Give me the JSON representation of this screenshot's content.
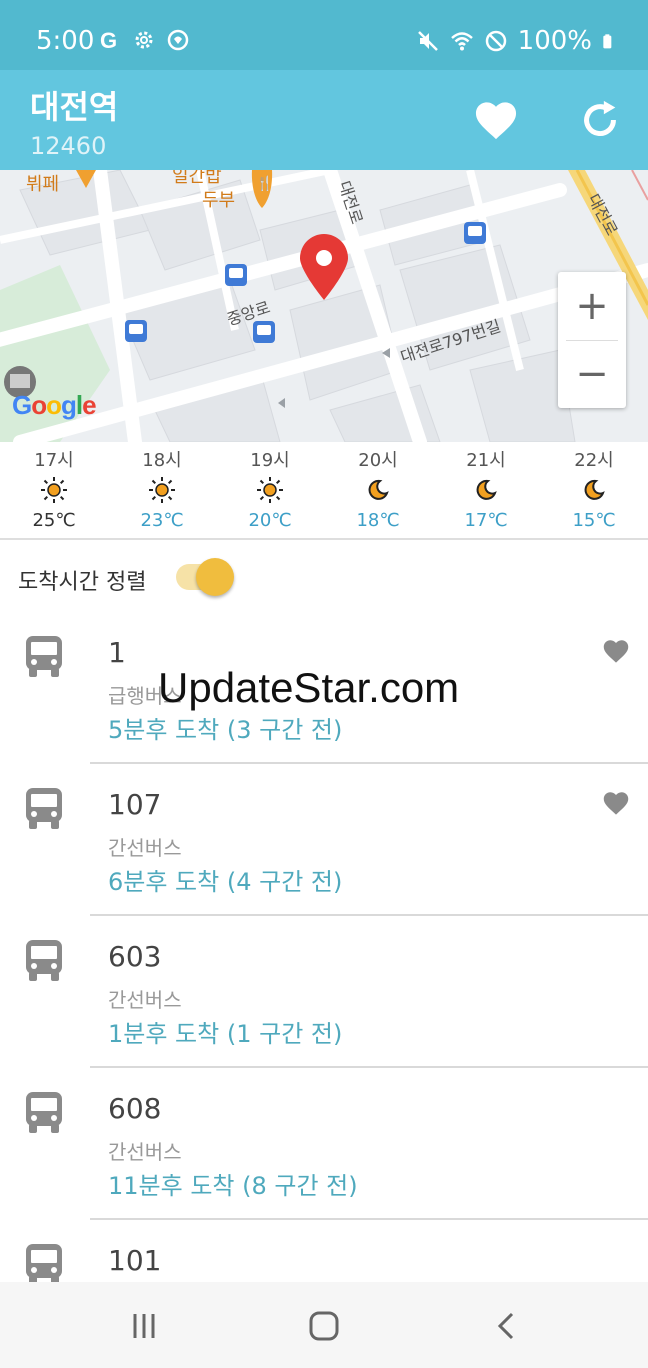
{
  "status_bar": {
    "time": "5:00",
    "battery": "100%",
    "left_icons": [
      "google-icon",
      "settings-icon",
      "app-notification-icon"
    ],
    "right_icons": [
      "mute-icon",
      "wifi-icon",
      "do-not-disturb-icon",
      "battery-icon"
    ]
  },
  "header": {
    "station_name": "대전역",
    "station_id": "12460",
    "favorite_icon": "heart-icon",
    "refresh_icon": "refresh-icon"
  },
  "map": {
    "labels": {
      "cafe": "뷔페",
      "restaurant_top": "일간밥",
      "restaurant": "두부",
      "road_daejeon_vertical": "대전로",
      "road_daejeon_right": "대전로",
      "road_jungang": "중앙로",
      "road_797": "대전로797번길"
    },
    "google_logo": "Google",
    "zoom_in": "+",
    "zoom_out": "−"
  },
  "weather": [
    {
      "hour": "17시",
      "icon": "sun-icon",
      "temp": "25℃",
      "color": "#333333"
    },
    {
      "hour": "18시",
      "icon": "sun-icon",
      "temp": "23℃",
      "color": "#3d9fc7"
    },
    {
      "hour": "19시",
      "icon": "sun-icon",
      "temp": "20℃",
      "color": "#3d9fc7"
    },
    {
      "hour": "20시",
      "icon": "moon-icon",
      "temp": "18℃",
      "color": "#3d9fc7"
    },
    {
      "hour": "21시",
      "icon": "moon-icon",
      "temp": "17℃",
      "color": "#3d9fc7"
    },
    {
      "hour": "22시",
      "icon": "moon-icon",
      "temp": "15℃",
      "color": "#3d9fc7"
    }
  ],
  "sort": {
    "label": "도착시간 정렬",
    "enabled": true
  },
  "buses": [
    {
      "number": "1",
      "type": "급행버스",
      "arrival": "5분후 도착 (3 구간 전)",
      "favorite": true
    },
    {
      "number": "107",
      "type": "간선버스",
      "arrival": "6분후 도착 (4 구간 전)",
      "favorite": true
    },
    {
      "number": "603",
      "type": "간선버스",
      "arrival": "1분후 도착 (1 구간 전)",
      "favorite": false
    },
    {
      "number": "608",
      "type": "간선버스",
      "arrival": "11분후 도착 (8 구간 전)",
      "favorite": false
    },
    {
      "number": "101",
      "type": "",
      "arrival": "",
      "favorite": false
    }
  ],
  "watermark": "UpdateStar.com",
  "colors": {
    "status_bar": "#52b9cf",
    "app_bar": "#62c6df",
    "arrival_text": "#4fa9bd",
    "toggle_knob": "#f0bd3e",
    "map_pin": "#e53935",
    "bus_stop": "#3f7ad6"
  },
  "nav": {
    "recents_icon": "recent-apps-icon",
    "home_icon": "home-icon",
    "back_icon": "back-icon"
  }
}
